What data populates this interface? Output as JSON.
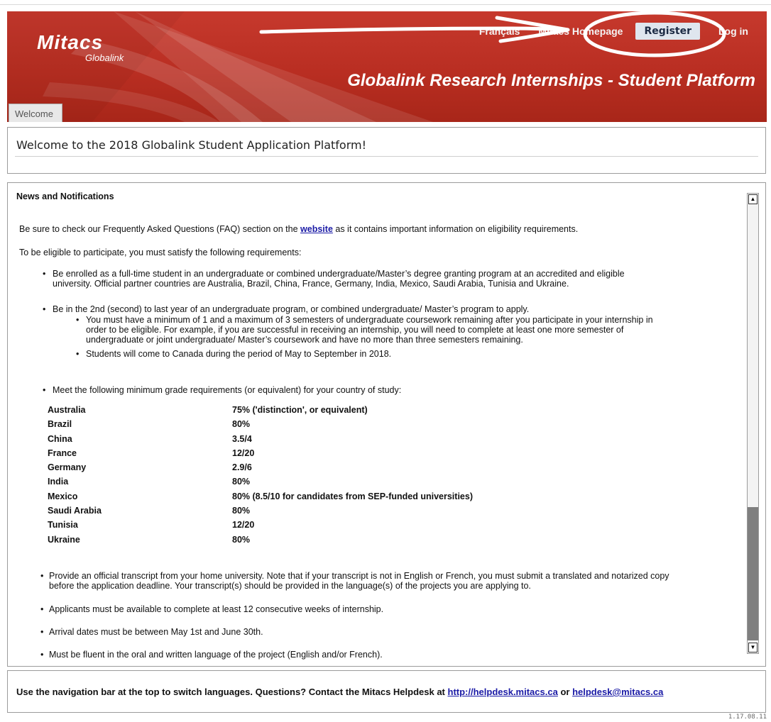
{
  "header": {
    "logo_main": "Mitacs",
    "logo_sub": "Globalink",
    "nav": {
      "francais": "Français",
      "homepage": "Mitacs Homepage",
      "register": "Register",
      "login": "Log in"
    },
    "platform_title": "Globalink Research Internships - Student Platform",
    "tab_welcome": "Welcome"
  },
  "welcome": {
    "text": "Welcome to the 2018 Globalink Student Application Platform!"
  },
  "news": {
    "heading": "News and Notifications",
    "faq_before": "Be sure to check our Frequently Asked Questions (FAQ) section on the ",
    "faq_link": "website",
    "faq_after": " as it contains important information on eligibility requirements.",
    "eligibility_intro": "To be eligible to participate, you must satisfy the following requirements:",
    "bullet_1_line1": "Be enrolled as a full-time student in an undergraduate or combined undergraduate/Master’s degree granting program at an accredited and eligible",
    "bullet_1_line2": "university. Official partner countries are Australia, Brazil, China, France, Germany, India, Mexico, Saudi Arabia, Tunisia and Ukraine.",
    "bullet_2": "Be in the 2nd (second) to last year of an undergraduate program, or combined undergraduate/ Master’s program to apply.",
    "sub_1_line1": "You must have a minimum of 1 and a maximum of 3 semesters of undergraduate coursework remaining after you participate in your internship in",
    "sub_1_line2": "order to be eligible. For example, if you are successful in receiving an internship, you will need to complete at least one more semester of",
    "sub_1_line3": "undergraduate or joint undergraduate/ Master’s coursework and have no more than three semesters remaining.",
    "sub_2": "Students will come to Canada during the period of May to September in 2018.",
    "bullet_3": "Meet the following minimum grade requirements (or equivalent) for your country of study:",
    "grades": [
      {
        "country": "Australia",
        "grade": "75% ('distinction', or equivalent)"
      },
      {
        "country": "Brazil",
        "grade": "80%"
      },
      {
        "country": "China",
        "grade": "3.5/4"
      },
      {
        "country": "France",
        "grade": "12/20"
      },
      {
        "country": "Germany",
        "grade": "2.9/6"
      },
      {
        "country": "India",
        "grade": "80%"
      },
      {
        "country": "Mexico",
        "grade": "80% (8.5/10 for candidates from SEP-funded universities)"
      },
      {
        "country": "Saudi Arabia",
        "grade": "80%"
      },
      {
        "country": "Tunisia",
        "grade": "12/20"
      },
      {
        "country": "Ukraine",
        "grade": "80%"
      }
    ],
    "bullet_4_line1": "Provide an official transcript from your home university. Note that if your transcript is not in English or French, you must submit a translated and notarized copy",
    "bullet_4_line2": "before the application deadline. Your transcript(s) should be provided in the language(s) of the projects you are applying to.",
    "bullet_5": "Applicants must be available to complete at least 12 consecutive weeks of internship.",
    "bullet_6": "Arrival dates must be between May 1st and June 30th.",
    "bullet_7": "Must be fluent in the oral and written language of the project (English and/or French)."
  },
  "footer": {
    "text_before": "Use the navigation bar at the top to switch languages. Questions? Contact the Mitacs Helpdesk at ",
    "helpdesk_link": "http://helpdesk.mitacs.ca",
    "or": " or ",
    "email_link": "helpdesk@mitacs.ca"
  },
  "version": "1.17.08.11",
  "colors": {
    "banner_red": "#b92e22",
    "link_blue": "#1a1aa6",
    "register_bg": "#dfe6ee",
    "scroll_thumb": "#7f7f7f"
  },
  "icons": {
    "scroll_up": "scroll-up-arrow-icon",
    "scroll_down": "scroll-down-arrow-icon"
  }
}
